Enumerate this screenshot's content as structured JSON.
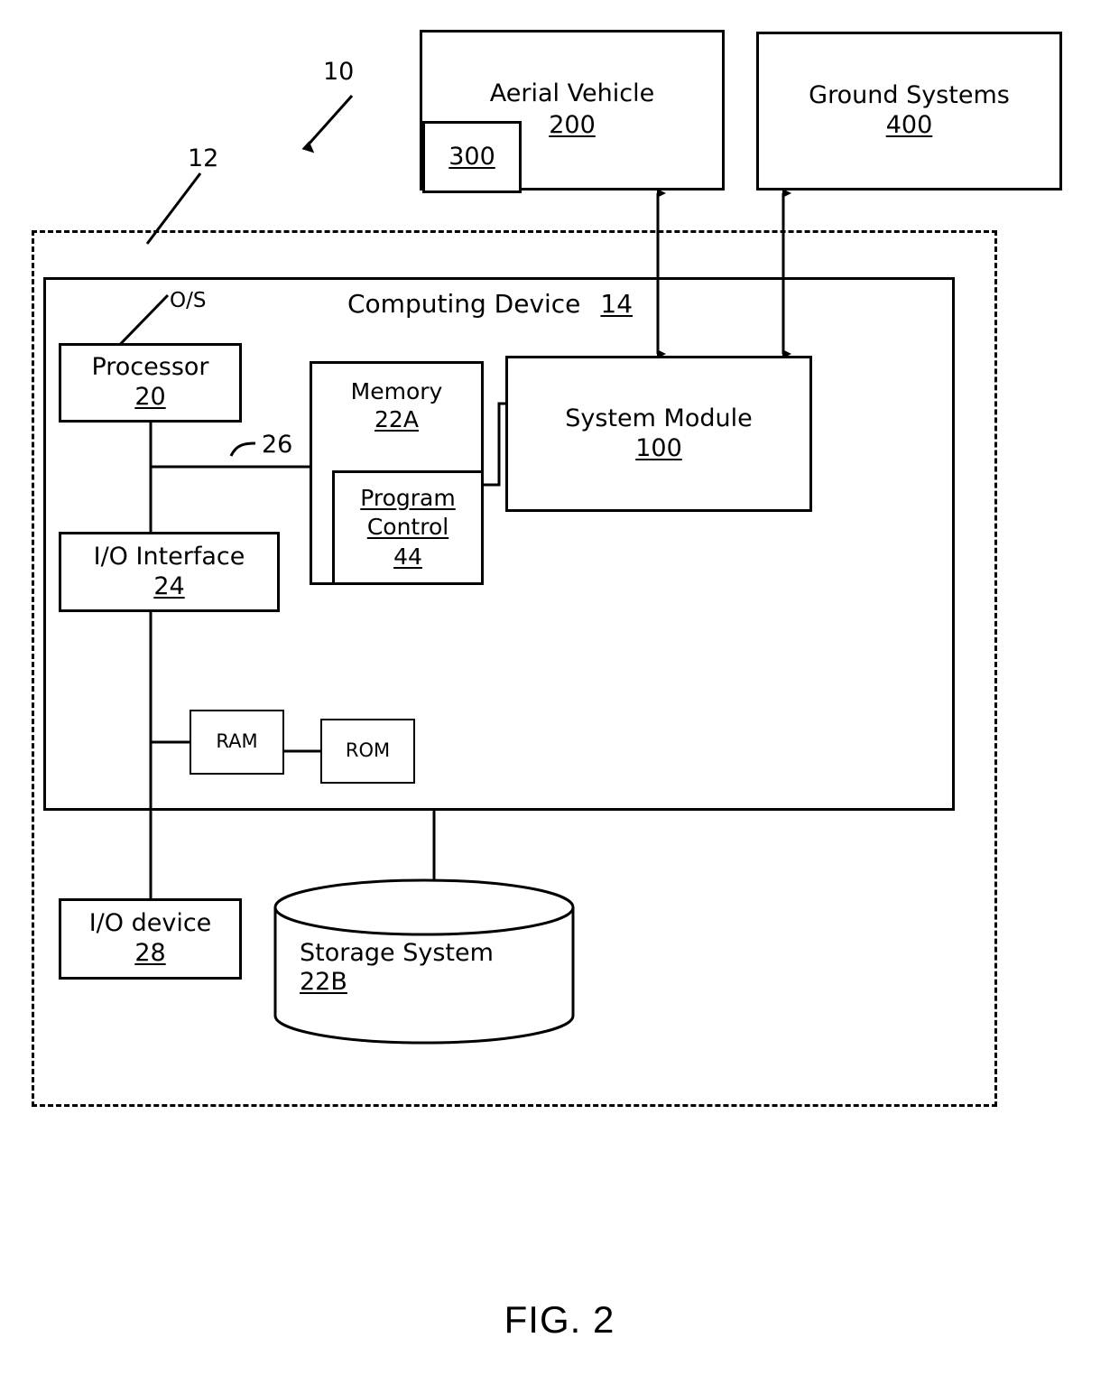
{
  "figure": {
    "caption": "FIG. 2",
    "reference_numerals": {
      "system": "10",
      "environment": "12",
      "os_callout": "O/S",
      "bus": "26"
    }
  },
  "top_blocks": {
    "aerial_vehicle": {
      "label": "Aerial Vehicle",
      "number": "200",
      "subsystem_number": "300"
    },
    "ground_systems": {
      "label": "Ground Systems",
      "number": "400"
    }
  },
  "computing_device": {
    "title": "Computing Device",
    "number": "14",
    "blocks": {
      "processor": {
        "label": "Processor",
        "number": "20"
      },
      "memory": {
        "label": "Memory",
        "number": "22A"
      },
      "program_control": {
        "line1": "Program",
        "line2": "Control",
        "number": "44"
      },
      "system_module": {
        "label": "System Module",
        "number": "100"
      },
      "io_interface": {
        "label": "I/O Interface",
        "number": "24"
      },
      "ram": {
        "label": "RAM"
      },
      "rom": {
        "label": "ROM"
      }
    }
  },
  "peripherals": {
    "io_device": {
      "label": "I/O device",
      "number": "28"
    },
    "storage_system": {
      "label": "Storage System",
      "number": "22B"
    }
  },
  "colors": {
    "stroke": "#000000",
    "background": "#ffffff"
  }
}
